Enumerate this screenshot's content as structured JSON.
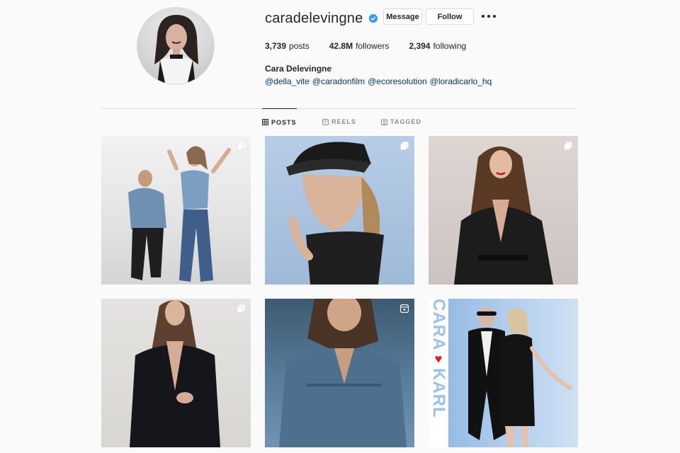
{
  "profile": {
    "username": "caradelevingne",
    "full_name": "Cara Delevingne",
    "verified_icon": "verified-badge-icon",
    "bio_links": [
      "@della_vite",
      "@caradonfilm",
      "@ecoresolution",
      "@loradicarlo_hq"
    ]
  },
  "actions": {
    "message_label": "Message",
    "follow_label": "Follow",
    "more_icon": "more-options-icon"
  },
  "stats": {
    "posts_count": "3,739",
    "posts_label": "posts",
    "followers_count": "42.8M",
    "followers_label": "followers",
    "following_count": "2,394",
    "following_label": "following"
  },
  "tabs": [
    {
      "label": "POSTS",
      "icon": "grid-icon",
      "active": true
    },
    {
      "label": "REELS",
      "icon": "reels-icon",
      "active": false
    },
    {
      "label": "TAGGED",
      "icon": "tagged-icon",
      "active": false
    }
  ],
  "posts": [
    {
      "badge": "multi-photo-icon"
    },
    {
      "badge": "multi-photo-icon"
    },
    {
      "badge": "multi-photo-icon"
    },
    {
      "badge": "multi-photo-icon"
    },
    {
      "badge": "reel-icon"
    },
    {
      "badge": null,
      "brand_text_top": "CARA",
      "brand_text_bottom": "KARL"
    }
  ],
  "colors": {
    "verified": "#3897f0",
    "link": "#00376b",
    "border": "#dbdbdb",
    "muted": "#8e8e8e",
    "heart": "#e02020"
  }
}
